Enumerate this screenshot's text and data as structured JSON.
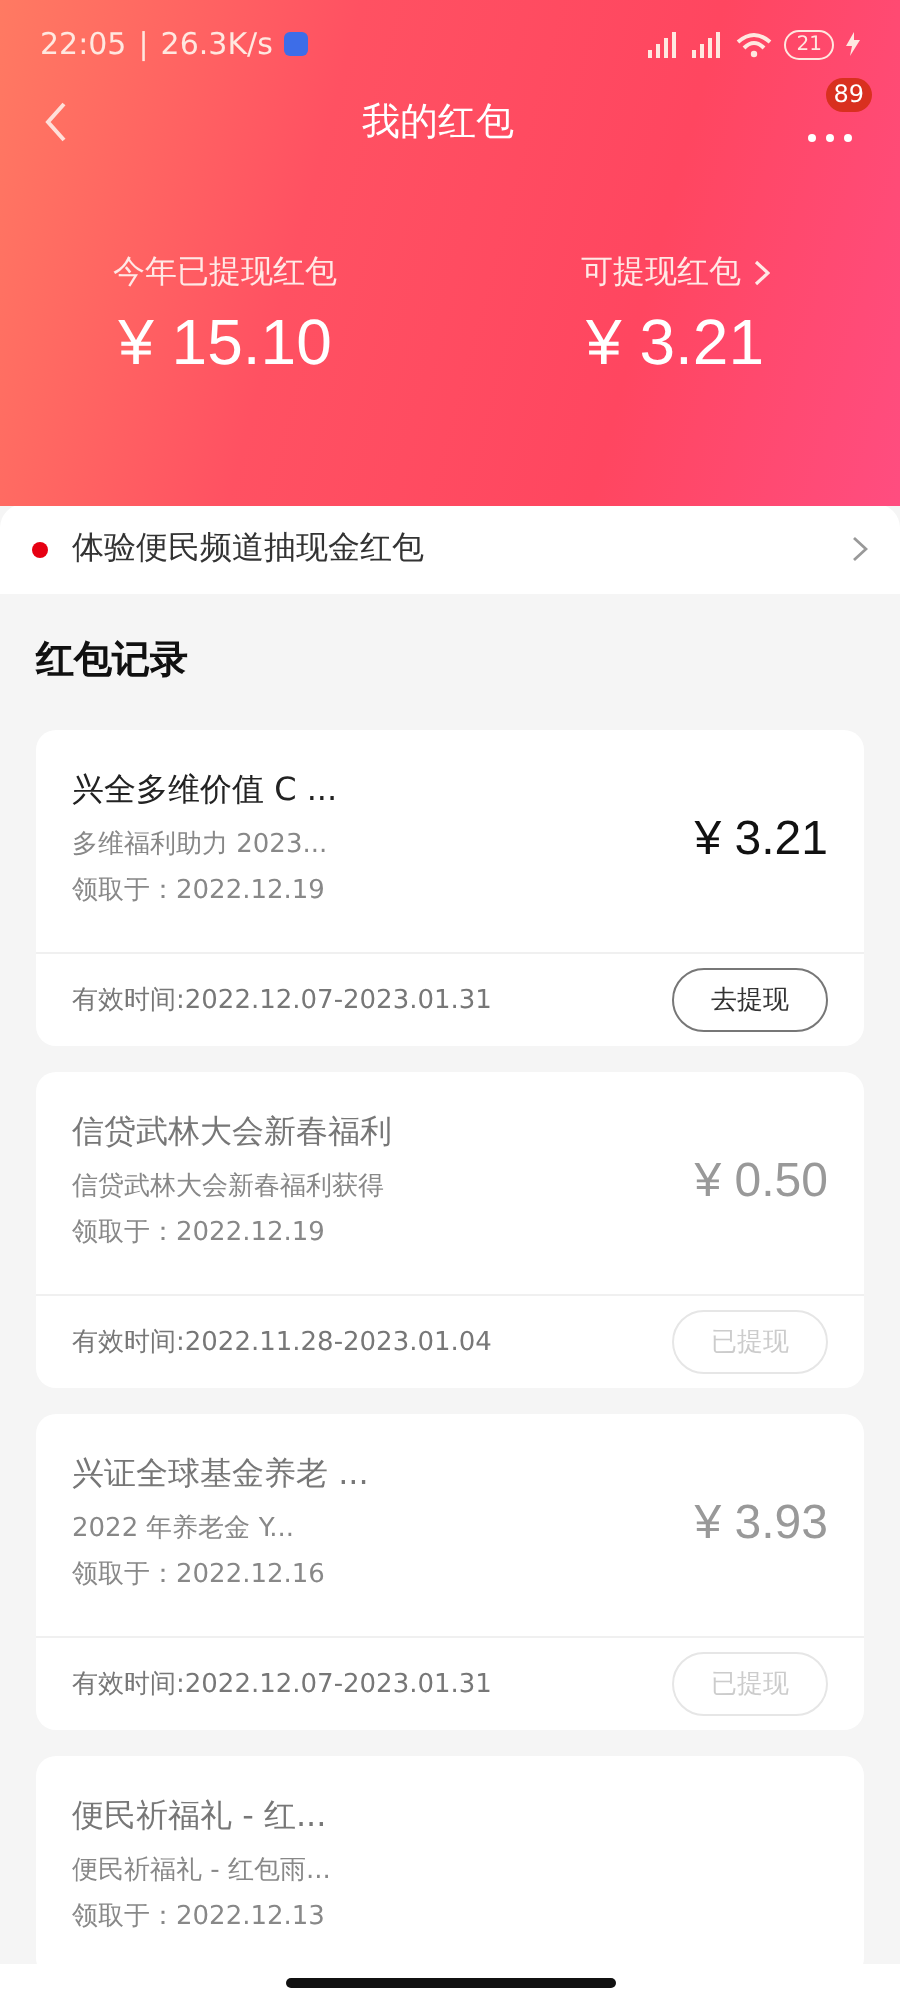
{
  "status_bar": {
    "time": "22:05",
    "divider": "|",
    "network_speed": "26.3K/s",
    "battery": "21"
  },
  "nav": {
    "title": "我的红包",
    "badge": "89"
  },
  "summary": [
    {
      "label": "今年已提现红包",
      "amount": "¥ 15.10",
      "link": false
    },
    {
      "label": "可提现红包",
      "amount": "¥ 3.21",
      "link": true
    }
  ],
  "notice": {
    "text": "体验便民频道抽现金红包"
  },
  "section_title": "红包记录",
  "records": [
    {
      "title": "兴全多维价值 C ...",
      "subtitle": "多维福利助力 2023...",
      "received": "领取于：2022.12.19",
      "amount": "¥ 3.21",
      "greyed": false,
      "validity": "有效时间:2022.12.07-2023.01.31",
      "button": {
        "label": "去提现",
        "disabled": false
      }
    },
    {
      "title": "信贷武林大会新春福利",
      "subtitle": "信贷武林大会新春福利获得",
      "received": "领取于：2022.12.19",
      "amount": "¥ 0.50",
      "greyed": true,
      "validity": "有效时间:2022.11.28-2023.01.04",
      "button": {
        "label": "已提现",
        "disabled": true
      }
    },
    {
      "title": "兴证全球基金养老 ...",
      "subtitle": "2022 年养老金 Y...",
      "received": "领取于：2022.12.16",
      "amount": "¥ 3.93",
      "greyed": true,
      "validity": "有效时间:2022.12.07-2023.01.31",
      "button": {
        "label": "已提现",
        "disabled": true
      }
    },
    {
      "title": "便民祈福礼 - 红...",
      "subtitle": "便民祈福礼 - 红包雨...",
      "received": "领取于：2022.12.13",
      "greyed": true
    }
  ]
}
